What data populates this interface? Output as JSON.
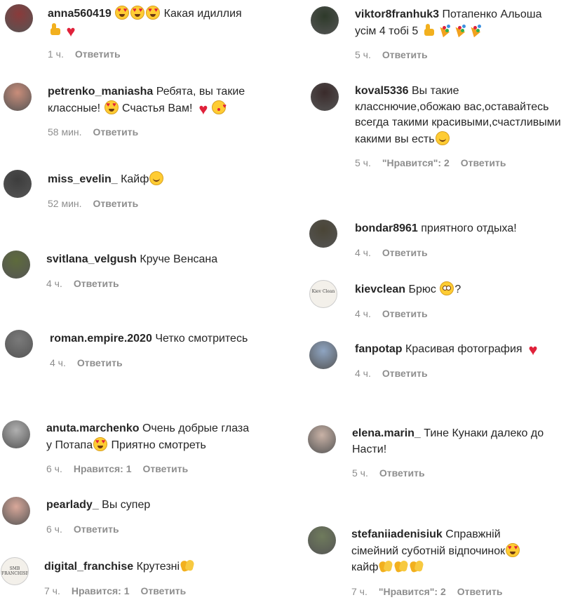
{
  "reply_label": "Ответить",
  "left_column": [
    {
      "username": "anna560419",
      "segments": [
        {
          "emoji": "heart-eyes-emoji"
        },
        {
          "emoji": "heart-eyes-emoji"
        },
        {
          "emoji": "heart-eyes-emoji"
        },
        {
          "t": " Какая идиллия "
        },
        {
          "emoji": "thumbs-up-emoji"
        },
        {
          "emoji": "red-heart-emoji"
        }
      ],
      "time": "1 ч.",
      "likes": null
    },
    {
      "username": "petrenko_maniasha",
      "segments": [
        {
          "t": "Ребята, вы такие классные! "
        },
        {
          "emoji": "heart-eyes-emoji"
        },
        {
          "t": " Счастья Вам! "
        },
        {
          "emoji": "red-heart-emoji"
        },
        {
          "emoji": "kissing-face-emoji"
        }
      ],
      "time": "58 мин.",
      "likes": null
    },
    {
      "username": "miss_evelin_",
      "segments": [
        {
          "t": "Кайф"
        },
        {
          "emoji": "smiling-face-emoji"
        }
      ],
      "time": "52 мин.",
      "likes": null
    },
    {
      "username": "svitlana_velgush",
      "segments": [
        {
          "t": "Круче Венсана"
        }
      ],
      "time": "4 ч.",
      "likes": null
    },
    {
      "username": "roman.empire.2020",
      "segments": [
        {
          "t": "Четко смотритесь"
        }
      ],
      "time": "4 ч.",
      "likes": null
    },
    {
      "username": "anuta.marchenko",
      "segments": [
        {
          "t": "Очень добрые глаза у Потапа"
        },
        {
          "emoji": "heart-eyes-emoji"
        },
        {
          "t": " Приятно смотреть"
        }
      ],
      "time": "6 ч.",
      "likes": "Нравится: 1"
    },
    {
      "username": "pearlady_",
      "segments": [
        {
          "t": " Вы супер"
        }
      ],
      "time": "6 ч.",
      "likes": null
    },
    {
      "username": "digital_franchise",
      "segments": [
        {
          "t": "Крутезні"
        },
        {
          "emoji": "clapping-hands-emoji"
        }
      ],
      "time": "7 ч.",
      "likes": "Нравится: 1"
    }
  ],
  "right_column": [
    {
      "username": "viktor8franhuk3",
      "segments": [
        {
          "t": "Потапенко Альоша усім 4 тобі 5 "
        },
        {
          "emoji": "thumbs-up-emoji"
        },
        {
          "emoji": "party-popper-emoji"
        },
        {
          "emoji": "party-popper-emoji"
        },
        {
          "emoji": "party-popper-emoji"
        }
      ],
      "time": "5 ч.",
      "likes": null
    },
    {
      "username": "koval5336",
      "segments": [
        {
          "t": "Вы такие класснючие,обожаю вас,оставайтесь всегда такими красивыми,счастливыми какими вы есть"
        },
        {
          "emoji": "smiling-face-emoji"
        }
      ],
      "time": "5 ч.",
      "likes": "\"Нравится\": 2"
    },
    {
      "username": "bondar8961",
      "segments": [
        {
          "t": "приятного отдыха!"
        }
      ],
      "time": "4 ч.",
      "likes": null
    },
    {
      "username": "kievclean",
      "segments": [
        {
          "t": "Брюс "
        },
        {
          "emoji": "flushed-face-emoji"
        },
        {
          "t": "?"
        }
      ],
      "time": "4 ч.",
      "likes": null
    },
    {
      "username": "fanpotap",
      "segments": [
        {
          "t": "Красивая фотография "
        },
        {
          "emoji": "red-heart-emoji"
        }
      ],
      "time": "4 ч.",
      "likes": null
    },
    {
      "username": "elena.marin_",
      "segments": [
        {
          "t": " Тине Кунаки далеко до Насти!"
        }
      ],
      "time": "5 ч.",
      "likes": null
    },
    {
      "username": "stefaniiadenisiuk",
      "segments": [
        {
          "t": "Справжній сімейний суботній відпочинок"
        },
        {
          "emoji": "heart-eyes-emoji"
        },
        {
          "t": " кайф"
        },
        {
          "emoji": "clapping-hands-emoji"
        },
        {
          "emoji": "clapping-hands-emoji"
        },
        {
          "emoji": "clapping-hands-emoji"
        }
      ],
      "time": "7 ч.",
      "likes": "\"Нравится\": 2"
    }
  ],
  "avatar_palette": {
    "left": [
      "#8a3a3a",
      "#c98d7a",
      "#3d3d3d",
      "#5e6b3c",
      "#7a7a7a",
      "#b0b0b0",
      "#d9a89a",
      "#e9e4dc"
    ],
    "right": [
      "#2e3a2a",
      "#3a2b2b",
      "#4a4536",
      "#5c4a3a",
      "#8fa5c2",
      "#c9b2a6",
      "#6f7b5c"
    ]
  },
  "avatar_labels": {
    "digital_franchise": "SMB\nFRANCHISE",
    "kievclean": "Kiev Clean"
  }
}
